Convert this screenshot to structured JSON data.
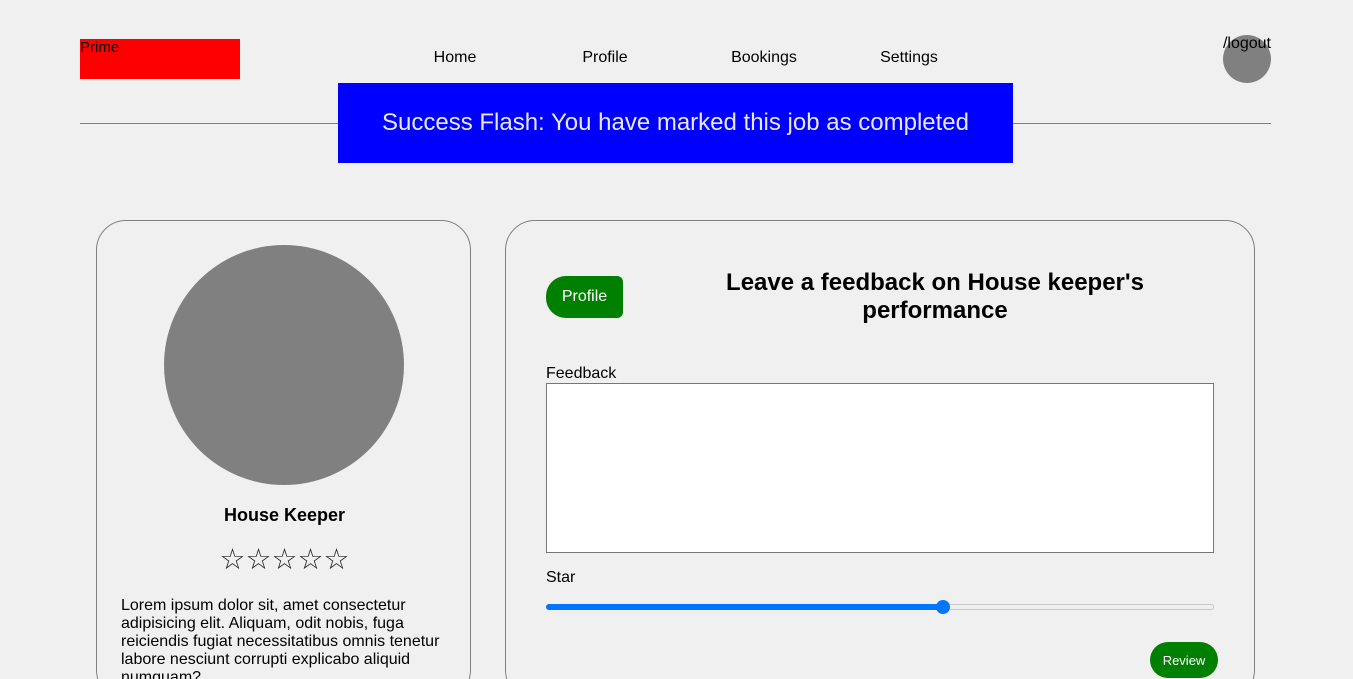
{
  "header": {
    "logo_text": "Prime",
    "nav": [
      "Home",
      "Profile",
      "Bookings",
      "Settings"
    ],
    "logout_text": "/logout"
  },
  "flash": {
    "message": "Success Flash: You have marked this job as completed",
    "background": "#0000ff"
  },
  "profile_card": {
    "name": "House Keeper",
    "rating_stars": "☆☆☆☆☆",
    "bio": "Lorem ipsum dolor sit, amet consectetur adipisicing elit. Aliquam, odit nobis, fuga reiciendis fugiat necessitatibus omnis tenetur labore nesciunt corrupti explicabo aliquid numquam?"
  },
  "feedback_form": {
    "profile_button": "Profile",
    "title": "Leave a feedback on House keeper's performance",
    "feedback_label": "Feedback",
    "feedback_value": "",
    "star_label": "Star",
    "star_slider_fraction": 0.595,
    "review_button": "Review"
  },
  "colors": {
    "accent_green": "#008000",
    "logo_red": "#ff0000",
    "slider_blue": "#0075ff"
  }
}
